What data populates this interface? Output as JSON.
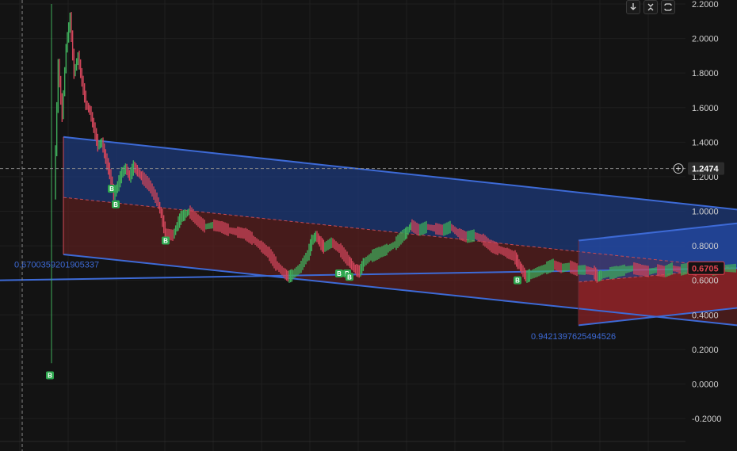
{
  "toolbar": {
    "buttons": [
      {
        "name": "download-icon",
        "glyph": "↓"
      },
      {
        "name": "collapse-icon",
        "glyph": "collapse"
      },
      {
        "name": "reset-icon",
        "glyph": "reset"
      }
    ]
  },
  "chart_data": {
    "type": "line",
    "title": "",
    "xlabel": "",
    "ylabel": "",
    "ylim": [
      -0.3,
      2.2
    ],
    "yticks": [
      "2.2000",
      "2.0000",
      "1.8000",
      "1.6000",
      "1.4000",
      "1.2000",
      "1.0000",
      "0.8000",
      "0.6000",
      "0.4000",
      "0.2000",
      "0.0000",
      "-0.2000"
    ],
    "ytick_values": [
      2.2,
      2.0,
      1.8,
      1.6,
      1.4,
      1.2,
      1.0,
      0.8,
      0.6,
      0.4,
      0.2,
      0.0,
      -0.2
    ],
    "grid": true,
    "colors": {
      "background": "#131313",
      "grid": "#1f1f1f",
      "up": "#3fae5b",
      "down": "#d0455a",
      "channel_line": "#3d6ad6",
      "upper_fill": "#1d3a7a",
      "lower_fill": "#5c2020",
      "marker": "#2ea84f",
      "current_price": "#e0434f"
    },
    "price_series": [
      [
        0.07,
        1.1
      ],
      [
        0.075,
        1.85
      ],
      [
        0.08,
        1.55
      ],
      [
        0.085,
        1.95
      ],
      [
        0.09,
        2.12
      ],
      [
        0.095,
        1.8
      ],
      [
        0.1,
        1.9
      ],
      [
        0.105,
        1.75
      ],
      [
        0.11,
        1.62
      ],
      [
        0.115,
        1.58
      ],
      [
        0.12,
        1.48
      ],
      [
        0.125,
        1.38
      ],
      [
        0.13,
        1.4
      ],
      [
        0.135,
        1.3
      ],
      [
        0.14,
        1.22
      ],
      [
        0.145,
        1.09
      ],
      [
        0.15,
        1.15
      ],
      [
        0.155,
        1.22
      ],
      [
        0.16,
        1.25
      ],
      [
        0.165,
        1.2
      ],
      [
        0.17,
        1.26
      ],
      [
        0.175,
        1.23
      ],
      [
        0.18,
        1.2
      ],
      [
        0.19,
        1.15
      ],
      [
        0.2,
        1.06
      ],
      [
        0.205,
        0.98
      ],
      [
        0.21,
        0.87
      ],
      [
        0.22,
        0.86
      ],
      [
        0.225,
        0.92
      ],
      [
        0.23,
        0.97
      ],
      [
        0.235,
        0.98
      ],
      [
        0.24,
        1.0
      ],
      [
        0.25,
        0.95
      ],
      [
        0.26,
        0.91
      ],
      [
        0.27,
        0.92
      ],
      [
        0.28,
        0.91
      ],
      [
        0.29,
        0.89
      ],
      [
        0.3,
        0.88
      ],
      [
        0.31,
        0.87
      ],
      [
        0.32,
        0.84
      ],
      [
        0.33,
        0.8
      ],
      [
        0.34,
        0.76
      ],
      [
        0.35,
        0.69
      ],
      [
        0.36,
        0.64
      ],
      [
        0.365,
        0.62
      ],
      [
        0.37,
        0.63
      ],
      [
        0.38,
        0.67
      ],
      [
        0.39,
        0.75
      ],
      [
        0.395,
        0.83
      ],
      [
        0.4,
        0.86
      ],
      [
        0.405,
        0.82
      ],
      [
        0.41,
        0.79
      ],
      [
        0.42,
        0.82
      ],
      [
        0.43,
        0.78
      ],
      [
        0.44,
        0.72
      ],
      [
        0.445,
        0.69
      ],
      [
        0.45,
        0.66
      ],
      [
        0.455,
        0.65
      ],
      [
        0.46,
        0.7
      ],
      [
        0.47,
        0.74
      ],
      [
        0.48,
        0.76
      ],
      [
        0.49,
        0.78
      ],
      [
        0.5,
        0.81
      ],
      [
        0.51,
        0.86
      ],
      [
        0.515,
        0.88
      ],
      [
        0.52,
        0.92
      ],
      [
        0.53,
        0.89
      ],
      [
        0.54,
        0.91
      ],
      [
        0.55,
        0.9
      ],
      [
        0.56,
        0.89
      ],
      [
        0.57,
        0.91
      ],
      [
        0.58,
        0.87
      ],
      [
        0.59,
        0.85
      ],
      [
        0.6,
        0.86
      ],
      [
        0.61,
        0.84
      ],
      [
        0.62,
        0.8
      ],
      [
        0.63,
        0.78
      ],
      [
        0.64,
        0.76
      ],
      [
        0.65,
        0.74
      ],
      [
        0.655,
        0.7
      ],
      [
        0.66,
        0.66
      ],
      [
        0.665,
        0.62
      ],
      [
        0.67,
        0.63
      ],
      [
        0.68,
        0.65
      ],
      [
        0.69,
        0.67
      ],
      [
        0.7,
        0.69
      ],
      [
        0.71,
        0.67
      ],
      [
        0.72,
        0.68
      ],
      [
        0.73,
        0.66
      ],
      [
        0.74,
        0.66
      ],
      [
        0.75,
        0.65
      ],
      [
        0.755,
        0.62
      ],
      [
        0.76,
        0.63
      ],
      [
        0.77,
        0.64
      ],
      [
        0.78,
        0.65
      ],
      [
        0.79,
        0.66
      ],
      [
        0.8,
        0.67
      ],
      [
        0.81,
        0.66
      ],
      [
        0.82,
        0.65
      ],
      [
        0.83,
        0.66
      ],
      [
        0.84,
        0.65
      ],
      [
        0.85,
        0.67
      ],
      [
        0.86,
        0.66
      ],
      [
        0.87,
        0.67
      ],
      [
        0.88,
        0.66
      ],
      [
        0.89,
        0.67
      ],
      [
        0.9,
        0.66
      ],
      [
        0.91,
        0.67
      ],
      [
        0.93,
        0.6705
      ]
    ],
    "spike_low": {
      "x": 0.065,
      "y": 0.12
    },
    "spike_high": {
      "x": 0.065,
      "y": 2.2
    },
    "channel": {
      "upper": {
        "start": [
          0.08,
          1.43
        ],
        "end": [
          0.93,
          1.01
        ]
      },
      "mid": {
        "start": [
          0.08,
          1.08
        ],
        "end": [
          0.93,
          0.67
        ]
      },
      "lower": {
        "start": [
          0.08,
          0.75
        ],
        "end": [
          0.93,
          0.34
        ]
      }
    },
    "projection": {
      "upper": {
        "start": [
          0.73,
          0.83
        ],
        "end": [
          0.93,
          0.93
        ]
      },
      "mid": {
        "start": [
          0.73,
          0.59
        ],
        "end": [
          0.93,
          0.67
        ]
      },
      "lower": {
        "start": [
          0.73,
          0.34
        ],
        "end": [
          0.93,
          0.44
        ]
      }
    },
    "support_line": {
      "start": [
        0.0,
        0.6
      ],
      "end": [
        0.93,
        0.67
      ]
    },
    "buy_markers": [
      {
        "x": 0.063,
        "y": 0.05,
        "label": "B"
      },
      {
        "x": 0.141,
        "y": 1.13,
        "label": "B"
      },
      {
        "x": 0.146,
        "y": 1.04,
        "label": "B"
      },
      {
        "x": 0.209,
        "y": 0.83,
        "label": "B"
      },
      {
        "x": 0.428,
        "y": 0.64,
        "label": "B"
      },
      {
        "x": 0.438,
        "y": 0.64,
        "label": "B"
      },
      {
        "x": 0.441,
        "y": 0.62,
        "label": "B"
      },
      {
        "x": 0.653,
        "y": 0.6,
        "label": "B"
      }
    ],
    "annotations": [
      {
        "text": "0.6700359201905337",
        "x": 0.018,
        "y": 0.675
      },
      {
        "text": "0.9421397625494526",
        "x": 0.67,
        "y": 0.26
      }
    ],
    "crosshair": {
      "value": 1.2474,
      "label": "1.2474",
      "x": 0.028
    },
    "current_price": {
      "value": 0.6705,
      "label": "0.6705"
    }
  }
}
